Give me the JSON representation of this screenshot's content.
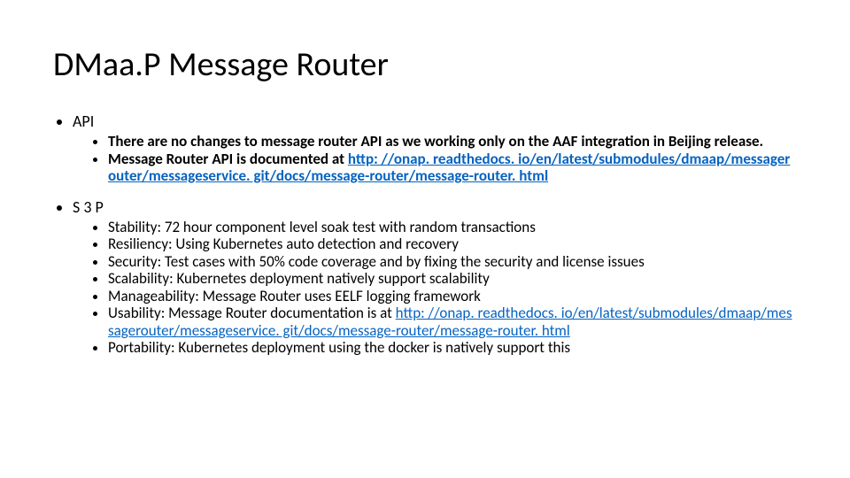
{
  "title": "DMaa.P Message Router",
  "sections": [
    {
      "label": "API",
      "items": [
        {
          "text": "There are no changes to message router API as we working only on the AAF integration in Beijing release."
        },
        {
          "text": "Message Router API is documented at ",
          "link": "http: //onap. readthedocs. io/en/latest/submodules/dmaap/messagerouter/messageservice. git/docs/message-router/message-router. html"
        }
      ]
    },
    {
      "label": "S 3 P",
      "items": [
        {
          "text": "Stability: 72 hour component level soak test with random transactions"
        },
        {
          "text": "Resiliency: Using Kubernetes auto detection and recovery"
        },
        {
          "text": "Security: Test cases with 50% code coverage and by fixing the security and license issues"
        },
        {
          "text": "Scalability: Kubernetes deployment natively support scalability"
        },
        {
          "text": "Manageability: Message Router uses EELF logging framework"
        },
        {
          "text": "Usability: Message Router documentation is at ",
          "link": "http: //onap. readthedocs. io/en/latest/submodules/dmaap/messagerouter/messageservice. git/docs/message-router/message-router. html"
        },
        {
          "text": "Portability: Kubernetes deployment using the docker is natively support this"
        }
      ]
    }
  ]
}
